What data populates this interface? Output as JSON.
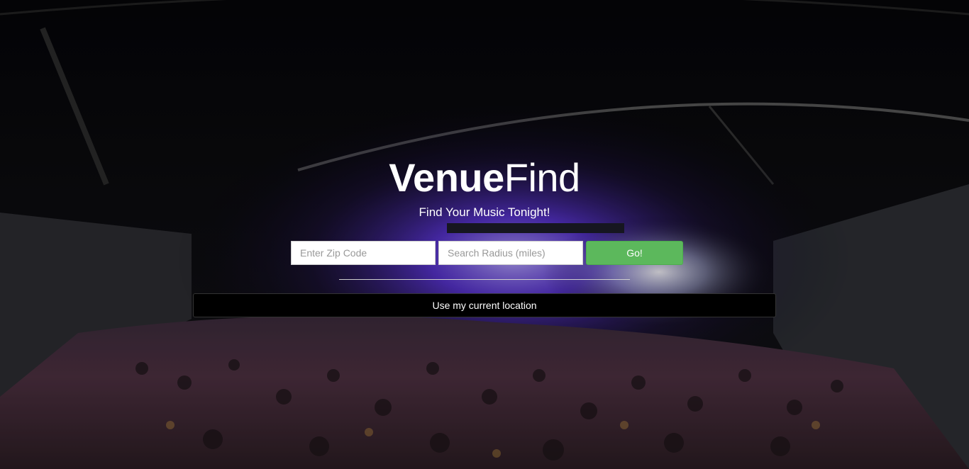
{
  "brand": {
    "name_bold": "Venue",
    "name_light": "Find"
  },
  "tagline": "Find Your Music Tonight!",
  "search": {
    "zip_placeholder": "Enter Zip Code",
    "zip_value": "",
    "radius_placeholder": "Search Radius (miles)",
    "radius_value": "",
    "go_label": "Go!"
  },
  "location_button": {
    "label": "Use my current location"
  },
  "colors": {
    "go_button": "#5cb85c",
    "location_button": "#000000",
    "text": "#ffffff",
    "stage_light": "#6a3cff"
  },
  "background": {
    "scene": "concert-crowd-photo"
  }
}
